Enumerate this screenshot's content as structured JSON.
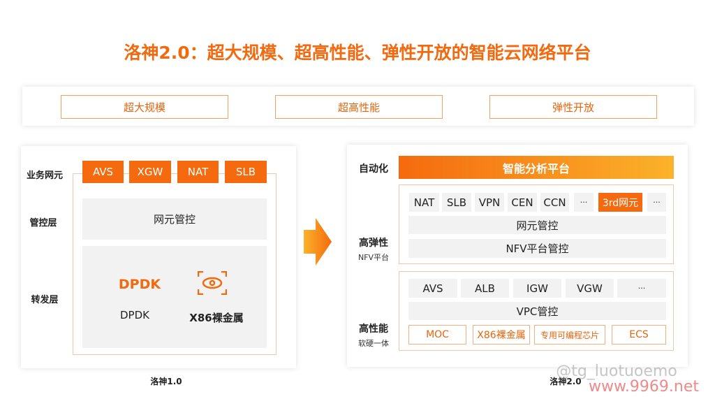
{
  "title": "洛神2.0：超大规模、超高性能、弹性开放的智能云网络平台",
  "features": [
    "超大规模",
    "超高性能",
    "弹性开放"
  ],
  "v1": {
    "caption": "洛神1.0",
    "layers": [
      "业务网元",
      "管控层",
      "转发层"
    ],
    "elements": [
      "AVS",
      "XGW",
      "NAT",
      "SLB"
    ],
    "control": "网元管控",
    "dpdk_logo": "DPDK",
    "dpdk": "DPDK",
    "x86": "X86裸金属"
  },
  "v2": {
    "caption": "洛神2.0",
    "auto_label": "自动化",
    "platform": "智能分析平台",
    "elastic_label": "高弹性",
    "elastic_sub": "NFV平台",
    "nfv_items": [
      "NAT",
      "SLB",
      "VPN",
      "CEN",
      "CCN",
      "···",
      "3rd网元",
      "···"
    ],
    "nfv_control": "网元管控",
    "nfv_platform": "NFV平台管控",
    "perf_label": "高性能",
    "perf_sub": "软硬一体",
    "vpc_items": [
      "AVS",
      "ALB",
      "IGW",
      "VGW",
      "···"
    ],
    "vpc_control": "VPC管控",
    "hw": [
      "MOC",
      "X86裸金属",
      "专用可编程芯片",
      "ECS"
    ]
  },
  "watermark": {
    "handle": "@tg_luotuoemo",
    "site": "www.9969.net"
  },
  "colors": {
    "accent": "#f56a0e",
    "gray": "#f2f2f2"
  }
}
